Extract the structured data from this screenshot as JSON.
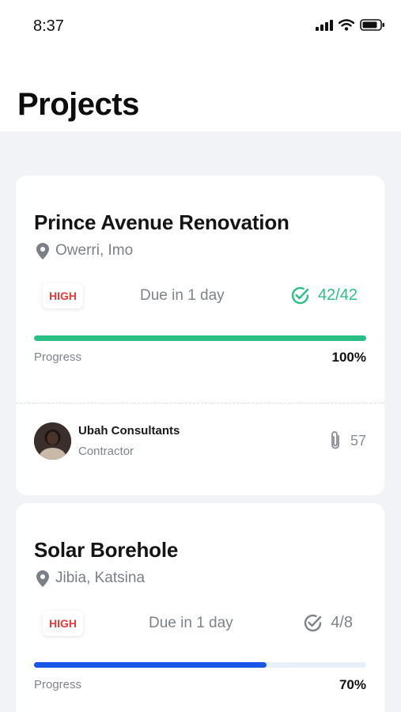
{
  "status_bar": {
    "time": "8:37"
  },
  "header": {
    "title": "Projects"
  },
  "colors": {
    "accent_green": "#2bbf85",
    "accent_blue": "#1a56e8",
    "priority_red": "#e23b3b"
  },
  "projects": [
    {
      "name": "Prince Avenue Renovation",
      "location": "Owerri, Imo",
      "priority": "HIGH",
      "due": "Due in 1 day",
      "tasks": "42/42",
      "progress_label": "Progress",
      "progress_value": "100%",
      "progress_fraction": 1.0,
      "contractor": {
        "name": "Ubah Consultants",
        "role": "Contractor"
      },
      "attachments": "57"
    },
    {
      "name": "Solar Borehole",
      "location": "Jibia, Katsina",
      "priority": "HIGH",
      "due": "Due in 1 day",
      "tasks": "4/8",
      "progress_label": "Progress",
      "progress_value": "70%",
      "progress_fraction": 0.7
    }
  ]
}
